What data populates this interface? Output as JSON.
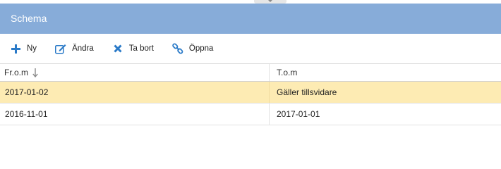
{
  "panel": {
    "title": "Schema"
  },
  "toolbar": {
    "buttons": [
      {
        "label": "Ny",
        "icon": "plus-icon"
      },
      {
        "label": "Ändra",
        "icon": "edit-icon"
      },
      {
        "label": "Ta bort",
        "icon": "delete-icon"
      },
      {
        "label": "Öppna",
        "icon": "link-icon"
      }
    ]
  },
  "table": {
    "columns": [
      {
        "label": "Fr.o.m",
        "sort": "descending"
      },
      {
        "label": "T.o.m"
      }
    ],
    "rows": [
      {
        "from": "2017-01-02",
        "to": "Gäller tillsvidare",
        "selected": true
      },
      {
        "from": "2016-11-01",
        "to": "2017-01-01",
        "selected": false
      }
    ]
  },
  "colors": {
    "header_bg": "#87acd9",
    "accent_blue": "#2a7ac8",
    "selected_row": "#fdebb3"
  }
}
